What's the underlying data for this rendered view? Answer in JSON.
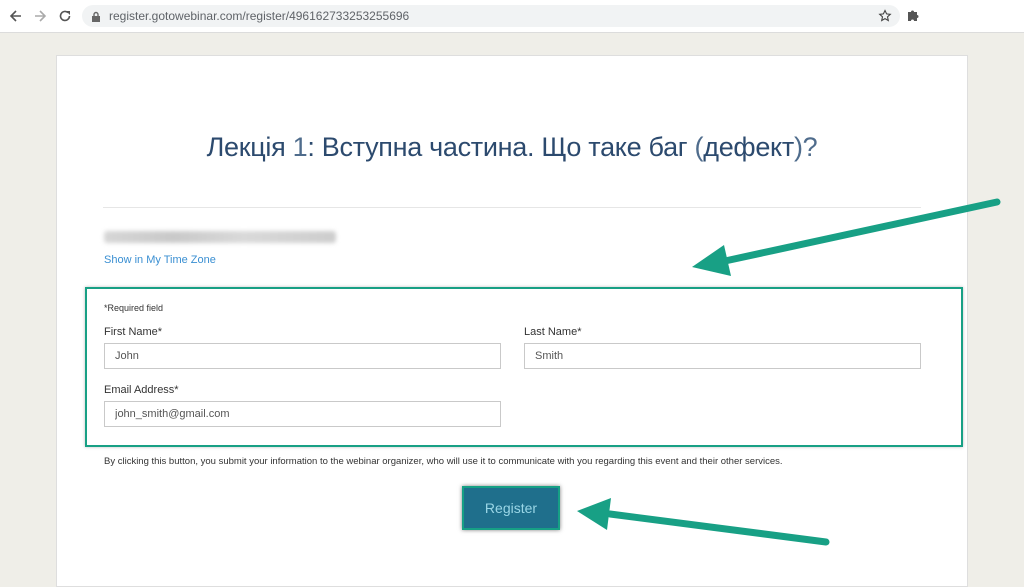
{
  "browser": {
    "url": "register.gotowebinar.com/register/496162733253255696",
    "icons": [
      "back-icon",
      "forward-icon",
      "reload-icon",
      "lock-icon",
      "star-icon",
      "extensions-icon"
    ]
  },
  "page": {
    "title_part1": "Лекція ",
    "title_num": "1",
    "title_part2": ": Вступна частина. Що таке баг ",
    "title_paren_open": "(",
    "title_part3": "дефект",
    "title_paren_close": ")?",
    "time_zone_link": "Show in My Time Zone",
    "required_note": "*Required field",
    "first_name_label": "First Name*",
    "first_name_value": "John",
    "last_name_label": "Last Name*",
    "last_name_value": "Smith",
    "email_label": "Email Address*",
    "email_value": "john_smith@gmail.com",
    "consent_text": "By clicking this button, you submit your information to the webinar organizer, who will use it to communicate with you regarding this event and their other services.",
    "register_label": "Register"
  },
  "colors": {
    "accent_arrow": "#18a085",
    "title": "#2c4a6e",
    "link": "#3a8fd2",
    "button": "#1f6f8c"
  }
}
